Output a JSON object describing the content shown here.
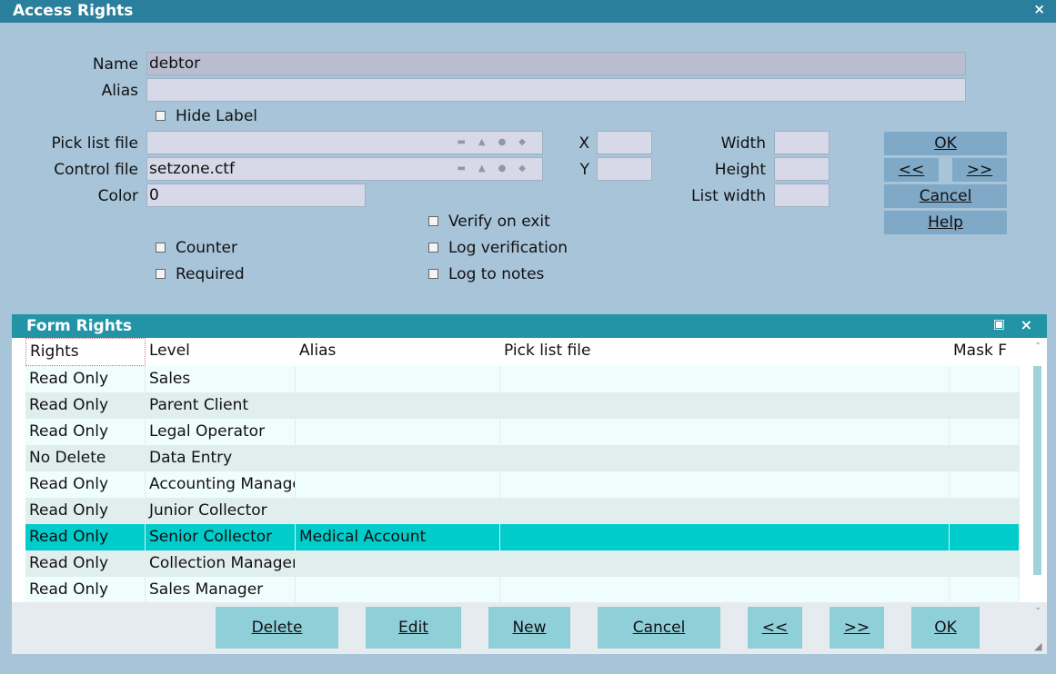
{
  "window": {
    "title": "Access Rights",
    "close": "×"
  },
  "fields": {
    "name_label": "Name",
    "name_value": "debtor",
    "alias_label": "Alias",
    "alias_value": "",
    "hide_label": "Hide Label",
    "picklist_label": "Pick list file",
    "picklist_value": "",
    "control_label": "Control file",
    "control_value": "setzone.ctf",
    "color_label": "Color",
    "color_value": "0",
    "x_label": "X",
    "y_label": "Y",
    "width_label": "Width",
    "height_label": "Height",
    "listwidth_label": "List width",
    "verify_on_exit": "Verify on exit",
    "log_verification": "Log verification",
    "log_to_notes": "Log to notes",
    "counter": "Counter",
    "required": "Required"
  },
  "side_buttons": {
    "ok": "OK",
    "prev": "<<",
    "next": ">>",
    "cancel": "Cancel",
    "help": "Help"
  },
  "form_rights": {
    "title": "Form Rights",
    "columns": [
      "Rights",
      "Level",
      "Alias",
      "Pick list file",
      "Mask F"
    ],
    "rows": [
      [
        "Read Only",
        "Sales",
        "",
        ""
      ],
      [
        "Read Only",
        "Parent Client",
        "",
        ""
      ],
      [
        "Read Only",
        "Legal Operator",
        "",
        ""
      ],
      [
        "No Delete",
        "Data Entry",
        "",
        ""
      ],
      [
        "Read Only",
        "Accounting Manager",
        "",
        ""
      ],
      [
        "Read Only",
        "Junior Collector",
        "",
        ""
      ],
      [
        "Read Only",
        "Senior Collector",
        "Medical Account",
        ""
      ],
      [
        "Read Only",
        "Collection Manager",
        "",
        ""
      ],
      [
        "Read Only",
        "Sales Manager",
        "",
        ""
      ]
    ],
    "selected_row": 6
  },
  "bottom_buttons": {
    "delete": "Delete",
    "edit": "Edit",
    "new": "New",
    "cancel": "Cancel",
    "prev": "<<",
    "next": ">>",
    "ok": "OK"
  },
  "colors": {
    "titlebar": "#2a7f9c",
    "form_bar": "#2394a6",
    "selected": "#00cccc",
    "row_even": "#f0fdfd",
    "row_odd": "#e1eeee"
  }
}
